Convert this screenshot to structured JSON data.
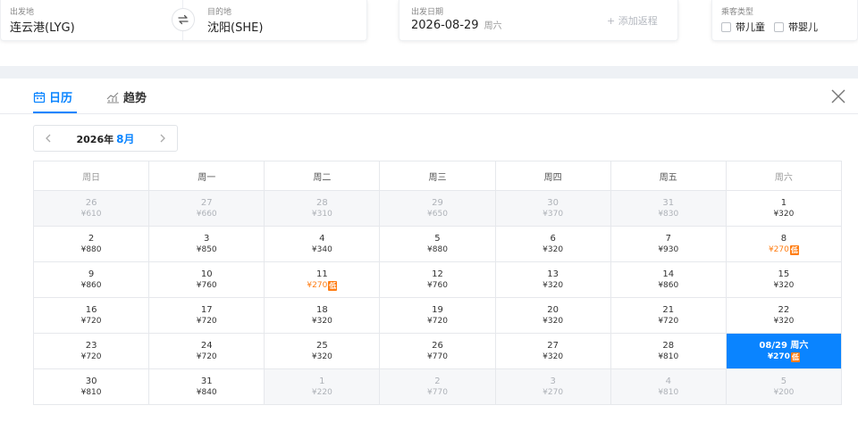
{
  "search": {
    "from_label": "出发地",
    "from_value": "连云港(LYG)",
    "to_label": "目的地",
    "to_value": "沈阳(SHE)",
    "date_label": "出发日期",
    "date_value": "2026-08-29",
    "date_weekday": "周六",
    "add_return": "+ 添加返程",
    "passenger_label": "乘客类型",
    "child_option": "带儿童",
    "infant_option": "带婴儿"
  },
  "tabs": {
    "calendar": "日历",
    "trend": "趋势"
  },
  "month_nav": {
    "year": "2026年",
    "month": "8月"
  },
  "calendar": {
    "weekdays": [
      "周日",
      "周一",
      "周二",
      "周三",
      "周四",
      "周五",
      "周六"
    ],
    "low_badge": "低",
    "weeks": [
      [
        {
          "day": "26",
          "price": "¥610",
          "other": true
        },
        {
          "day": "27",
          "price": "¥660",
          "other": true
        },
        {
          "day": "28",
          "price": "¥310",
          "other": true
        },
        {
          "day": "29",
          "price": "¥650",
          "other": true
        },
        {
          "day": "30",
          "price": "¥370",
          "other": true
        },
        {
          "day": "31",
          "price": "¥830",
          "other": true
        },
        {
          "day": "1",
          "price": "¥320"
        }
      ],
      [
        {
          "day": "2",
          "price": "¥880"
        },
        {
          "day": "3",
          "price": "¥850"
        },
        {
          "day": "4",
          "price": "¥340"
        },
        {
          "day": "5",
          "price": "¥880"
        },
        {
          "day": "6",
          "price": "¥320"
        },
        {
          "day": "7",
          "price": "¥930"
        },
        {
          "day": "8",
          "price": "¥270",
          "low": true
        }
      ],
      [
        {
          "day": "9",
          "price": "¥860"
        },
        {
          "day": "10",
          "price": "¥760"
        },
        {
          "day": "11",
          "price": "¥270",
          "low": true
        },
        {
          "day": "12",
          "price": "¥760"
        },
        {
          "day": "13",
          "price": "¥320"
        },
        {
          "day": "14",
          "price": "¥860"
        },
        {
          "day": "15",
          "price": "¥320"
        }
      ],
      [
        {
          "day": "16",
          "price": "¥720"
        },
        {
          "day": "17",
          "price": "¥720"
        },
        {
          "day": "18",
          "price": "¥320"
        },
        {
          "day": "19",
          "price": "¥720"
        },
        {
          "day": "20",
          "price": "¥320"
        },
        {
          "day": "21",
          "price": "¥720"
        },
        {
          "day": "22",
          "price": "¥320"
        }
      ],
      [
        {
          "day": "23",
          "price": "¥720"
        },
        {
          "day": "24",
          "price": "¥720"
        },
        {
          "day": "25",
          "price": "¥320"
        },
        {
          "day": "26",
          "price": "¥770"
        },
        {
          "day": "27",
          "price": "¥320"
        },
        {
          "day": "28",
          "price": "¥810"
        },
        {
          "day": "08/29 周六",
          "price": "¥270",
          "low": true,
          "selected": true
        }
      ],
      [
        {
          "day": "30",
          "price": "¥810"
        },
        {
          "day": "31",
          "price": "¥840"
        },
        {
          "day": "1",
          "price": "¥220",
          "other": true
        },
        {
          "day": "2",
          "price": "¥770",
          "other": true
        },
        {
          "day": "3",
          "price": "¥270",
          "other": true
        },
        {
          "day": "4",
          "price": "¥810",
          "other": true
        },
        {
          "day": "5",
          "price": "¥200",
          "other": true
        }
      ]
    ]
  },
  "colors": {
    "accent": "#0a84ff",
    "low_price": "#ff7d13"
  }
}
